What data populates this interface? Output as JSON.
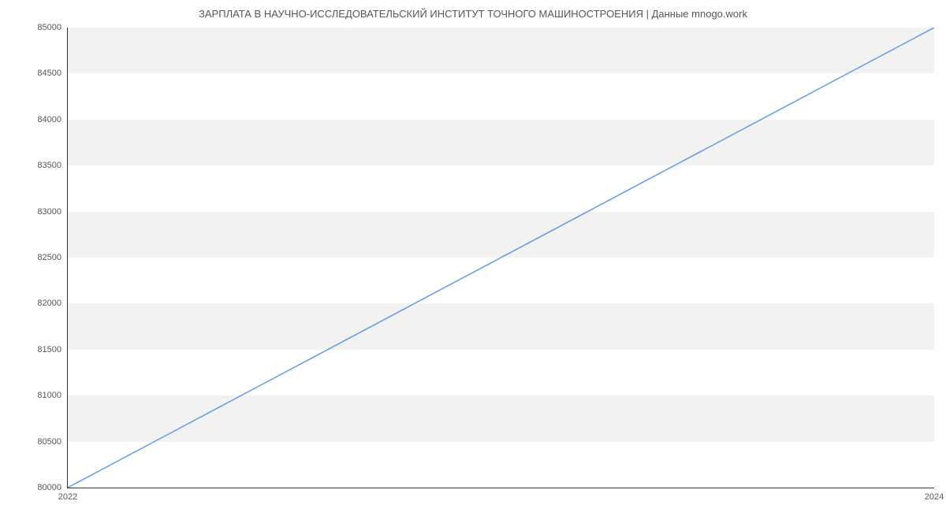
{
  "chart_data": {
    "type": "line",
    "title": "ЗАРПЛАТА В  НАУЧНО-ИССЛЕДОВАТЕЛЬСКИЙ ИНСТИТУТ ТОЧНОГО МАШИНОСТРОЕНИЯ | Данные mnogo.work",
    "x": [
      2022,
      2024
    ],
    "values": [
      80000,
      85000
    ],
    "xlabel": "",
    "ylabel": "",
    "xlim": [
      2022,
      2024
    ],
    "ylim": [
      80000,
      85000
    ],
    "x_ticks": [
      2022,
      2024
    ],
    "y_ticks": [
      80000,
      80500,
      81000,
      81500,
      82000,
      82500,
      83000,
      83500,
      84000,
      84500,
      85000
    ],
    "line_color": "#6699dd"
  }
}
